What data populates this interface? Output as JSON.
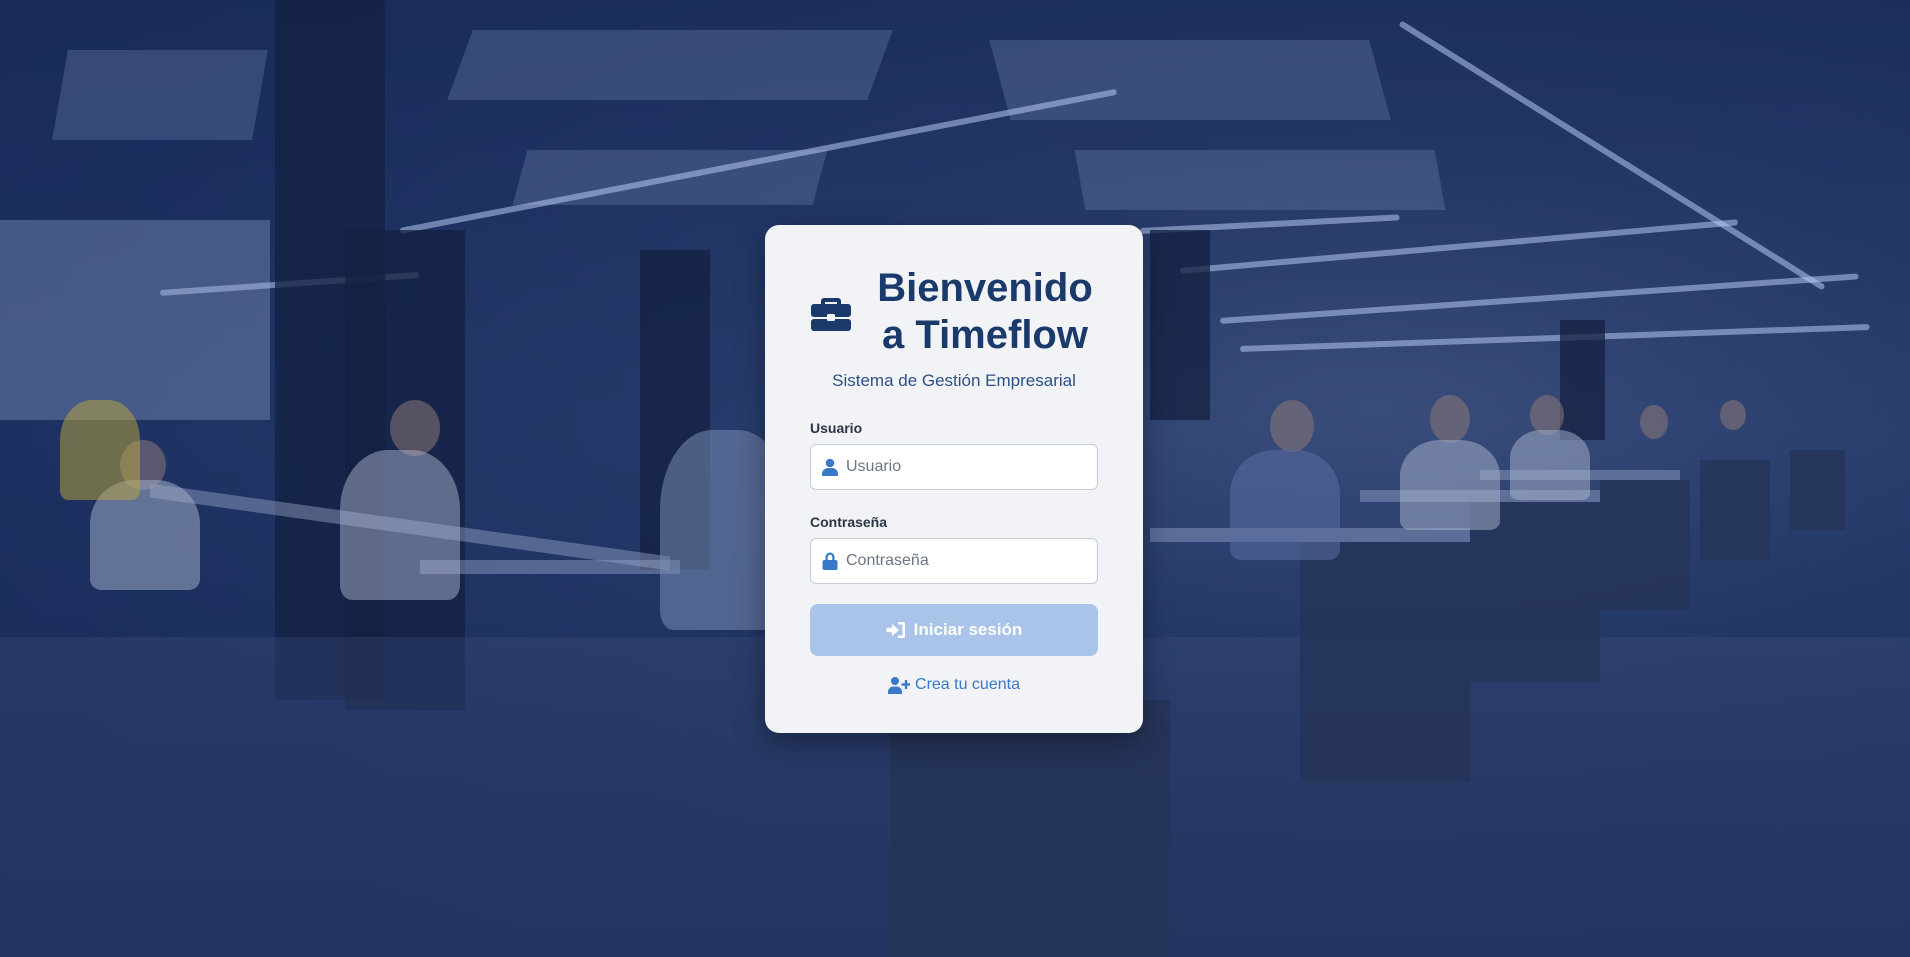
{
  "login": {
    "title_line1": "Bienvenido",
    "title_line2": "a Timeflow",
    "subtitle": "Sistema de Gestión Empresarial",
    "username_label": "Usuario",
    "username_placeholder": "Usuario",
    "username_value": "",
    "password_label": "Contraseña",
    "password_placeholder": "Contraseña",
    "password_value": "",
    "submit_label": "Iniciar sesión",
    "signup_label": "Crea tu cuenta"
  },
  "icons": {
    "logo": "briefcase-icon",
    "username": "user-icon",
    "password": "lock-icon",
    "submit": "sign-in-icon",
    "signup": "user-plus-icon"
  },
  "colors": {
    "title": "#1a3a6b",
    "accent": "#3a78c8",
    "button_disabled": "#a9c4e8",
    "overlay": "#1f3364"
  }
}
